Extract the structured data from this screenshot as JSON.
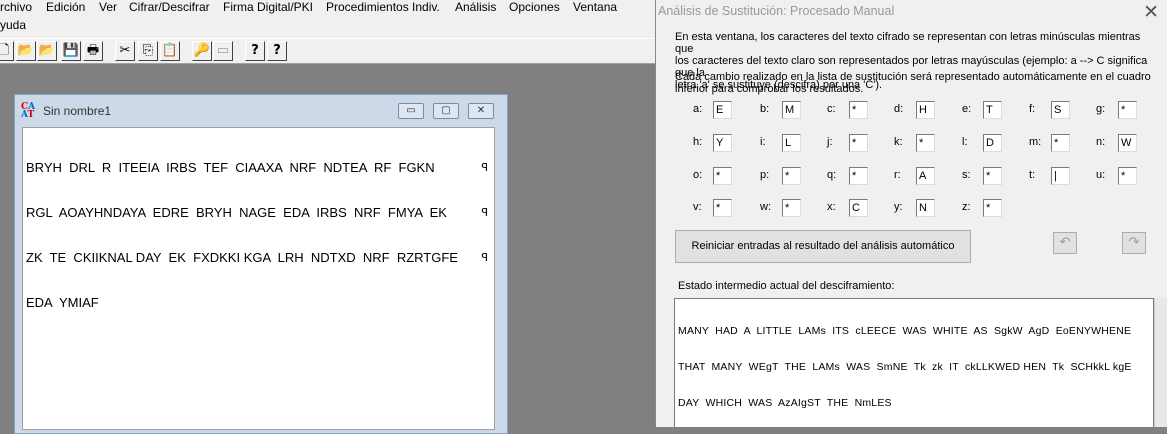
{
  "menu": [
    "rchivo",
    "Edición",
    "Ver",
    "Cifrar/Descifrar",
    "Firma Digital/PKI",
    "Procedimientos Indiv.",
    "Análisis",
    "Opciones",
    "Ventana",
    "yuda"
  ],
  "toolbar": {
    "icons": [
      "new-icon",
      "open-icon",
      "open-folder-icon",
      "save-icon",
      "print-icon",
      "cut-icon",
      "copy-icon",
      "paste-icon",
      "key-icon",
      "window-icon",
      "help-icon",
      "context-help-icon"
    ],
    "glyphs": [
      "🗋",
      "📂",
      "📂",
      "💾",
      "🖶",
      "✂",
      "⎘",
      "📋",
      "🔑",
      "▭",
      "?",
      "?"
    ]
  },
  "child_window": {
    "icon_text": "CAAT",
    "title": "Sin nombre1",
    "buttons": {
      "minimize": "▭",
      "maximize": "▢",
      "close": "✕"
    },
    "lines": [
      "BRYH  DRL  R  ITEEIA  IRBS  TEF  CIAAXA  NRF  NDTEA  RF  FGKN",
      "RGL  AOAYHNDAYA  EDRE  BRYH  NAGE  EDA  IRBS  NRF  FMYA  EK",
      "ZK  TE  CKIIKNAL DAY  EK  FXDKKI KGA  LRH  NDTXD  NRF  RZRTGFE",
      "EDA  YMIAF"
    ],
    "line_mark": "ꟼ"
  },
  "dialog": {
    "title": "Análisis de Sustitución: Procesado Manual",
    "close": "✕",
    "intro": [
      "En esta ventana, los caracteres del texto cifrado se representan con letras minúsculas mientras que",
      "los caracteres del texto claro son representados por letras mayúsculas (ejemplo: a --> C significa que la",
      "letra 'a' se sustituye (descifra) por una  'C').",
      "Cada cambio realizado en la lista de sustitución será representado automáticamente en el cuadro",
      "inferior para comprobar los resultados."
    ],
    "substitutions": [
      {
        "cipher": "a:",
        "plain": "E"
      },
      {
        "cipher": "b:",
        "plain": "M"
      },
      {
        "cipher": "c:",
        "plain": "*"
      },
      {
        "cipher": "d:",
        "plain": "H"
      },
      {
        "cipher": "e:",
        "plain": "T"
      },
      {
        "cipher": "f:",
        "plain": "S"
      },
      {
        "cipher": "g:",
        "plain": "*"
      },
      {
        "cipher": "h:",
        "plain": "Y"
      },
      {
        "cipher": "i:",
        "plain": "L"
      },
      {
        "cipher": "j:",
        "plain": "*"
      },
      {
        "cipher": "k:",
        "plain": "*"
      },
      {
        "cipher": "l:",
        "plain": "D"
      },
      {
        "cipher": "m:",
        "plain": "*"
      },
      {
        "cipher": "n:",
        "plain": "W"
      },
      {
        "cipher": "o:",
        "plain": "*"
      },
      {
        "cipher": "p:",
        "plain": "*"
      },
      {
        "cipher": "q:",
        "plain": "*"
      },
      {
        "cipher": "r:",
        "plain": "A"
      },
      {
        "cipher": "s:",
        "plain": "*"
      },
      {
        "cipher": "t:",
        "plain": "|"
      },
      {
        "cipher": "u:",
        "plain": "*"
      },
      {
        "cipher": "v:",
        "plain": "*"
      },
      {
        "cipher": "w:",
        "plain": "*"
      },
      {
        "cipher": "x:",
        "plain": "C"
      },
      {
        "cipher": "y:",
        "plain": "N"
      },
      {
        "cipher": "z:",
        "plain": "*"
      }
    ],
    "reset_label": "Reiniciar entradas al resultado del análisis automático",
    "undo": "↶",
    "redo": "↷",
    "state_label": "Estado intermedio actual del desciframiento:",
    "state_lines": [
      "MANY  HAD  A  LITTLE  LAMs  ITS  cLEECE  WAS  WHITE  AS  SgkW  AgD  EoENYWHENE",
      "THAT  MANY  WEgT  THE  LAMs  WAS  SmNE  Tk  zk  IT  ckLLKWED HEN  Tk  SCHkkL kgE",
      "DAY  WHICH  WAS  AzAIgST  THE  NmLES"
    ]
  }
}
